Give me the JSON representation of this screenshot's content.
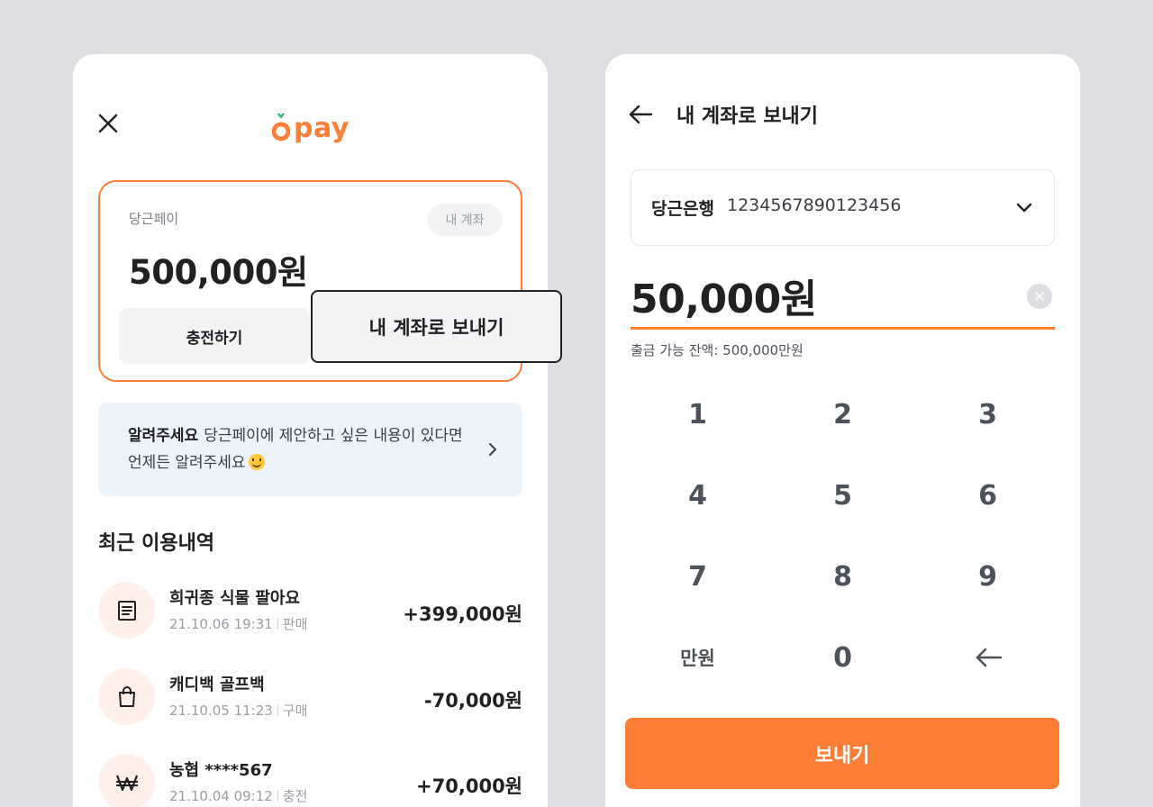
{
  "left": {
    "logo": "pay",
    "card": {
      "label": "당근페이",
      "my_account_chip": "내 계좌",
      "balance": "500,000원",
      "charge_button": "충전하기"
    },
    "tooltip": "내 계좌로 보내기",
    "notice": {
      "strong": "알려주세요",
      "text": "당근페이에 제안하고 싶은 내용이 있다면 언제든 알려주세요"
    },
    "recent_title": "최근 이용내역",
    "transactions": [
      {
        "title": "희귀종 식물 팔아요",
        "date": "21.10.06 19:31",
        "type": "판매",
        "amount": "+399,000원",
        "icon": "receipt-icon"
      },
      {
        "title": "캐디백 골프백",
        "date": "21.10.05 11:23",
        "type": "구매",
        "amount": "-70,000원",
        "icon": "shopping-bag-icon"
      },
      {
        "title": "농협 ****567",
        "date": "21.10.04 09:12",
        "type": "충전",
        "amount": "+70,000원",
        "icon": "won-icon"
      }
    ]
  },
  "right": {
    "title": "내 계좌로 보내기",
    "account": {
      "bank": "당근은행",
      "number": "1234567890123456"
    },
    "amount": "50,000원",
    "available": "출금 가능 잔액: 500,000만원",
    "keys": [
      "1",
      "2",
      "3",
      "4",
      "5",
      "6",
      "7",
      "8",
      "9",
      "만원",
      "0"
    ],
    "send_button": "보내기"
  },
  "colors": {
    "accent": "#ff7e36",
    "background": "#dddfe3",
    "notice_bg": "#eaf4fa"
  }
}
